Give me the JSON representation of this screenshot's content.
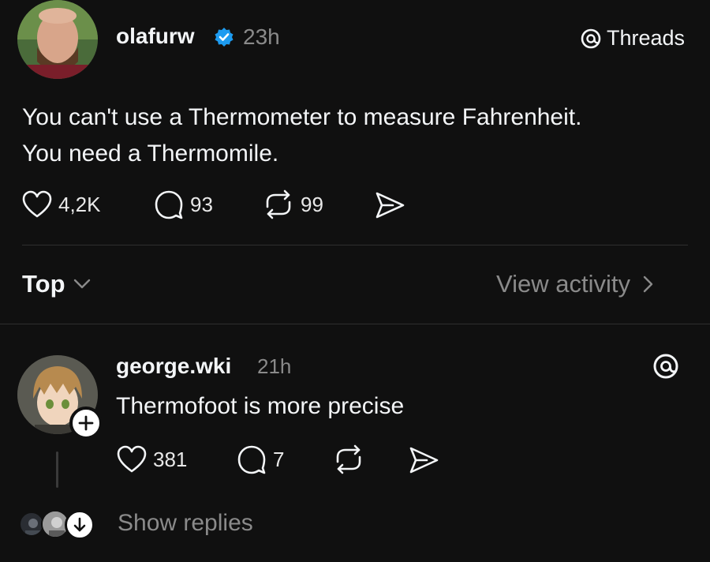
{
  "post": {
    "username": "olafurw",
    "time": "23h",
    "verified": true,
    "brand_label": "Threads",
    "text_line1": "You can't use a Thermometer to measure Fahrenheit.",
    "text_line2": "You need a Thermomile.",
    "likes": "4,2K",
    "replies": "93",
    "reposts": "99"
  },
  "filter": {
    "sort_label": "Top",
    "view_activity_label": "View activity"
  },
  "reply": {
    "username": "george.wki",
    "time": "21h",
    "text": "Thermofoot is more precise",
    "likes": "381",
    "replies": "7"
  },
  "footer": {
    "show_replies_label": "Show replies"
  },
  "colors": {
    "background": "#101010",
    "verified_badge": "#1d9bf0",
    "muted_text": "#8a8a8a"
  }
}
